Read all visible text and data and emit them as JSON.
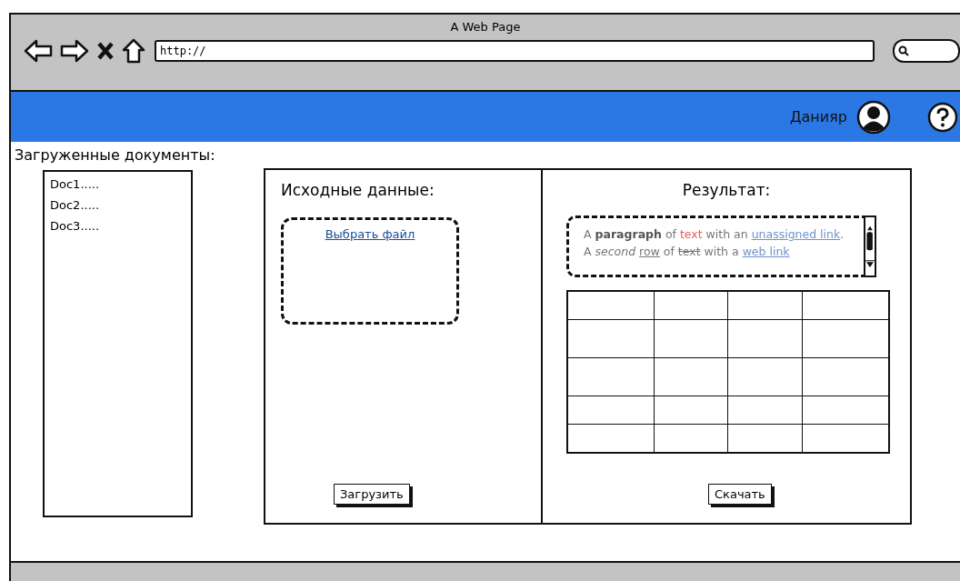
{
  "window": {
    "title": "A Web Page",
    "url": "http://"
  },
  "header": {
    "user_name": "Данияр"
  },
  "documents": {
    "title": "Загруженные документы:",
    "items": [
      {
        "label": "Doc1....."
      },
      {
        "label": "Doc2....."
      },
      {
        "label": "Doc3....."
      }
    ]
  },
  "source_panel": {
    "title": "Исходные данные:",
    "file_link": "Выбрать файл",
    "button": "Загрузить"
  },
  "result_panel": {
    "title": "Результат:",
    "paragraph_lines": [
      [
        {
          "kind": "plain",
          "text": "A "
        },
        {
          "kind": "bold",
          "text": "paragraph"
        },
        {
          "kind": "plain",
          "text": " of "
        },
        {
          "kind": "red",
          "text": "text"
        },
        {
          "kind": "plain",
          "text": " with an "
        },
        {
          "kind": "link",
          "text": "unassigned link"
        },
        {
          "kind": "plain",
          "text": "."
        }
      ],
      [
        {
          "kind": "plain",
          "text": "A "
        },
        {
          "kind": "italic",
          "text": "second"
        },
        {
          "kind": "underline",
          "text": "row",
          "gap_before": true
        },
        {
          "kind": "plain",
          "text": " of "
        },
        {
          "kind": "strike",
          "text": "text"
        },
        {
          "kind": "plain",
          "text": " with a "
        },
        {
          "kind": "link",
          "text": "web link"
        }
      ]
    ],
    "button": "Скачать"
  }
}
